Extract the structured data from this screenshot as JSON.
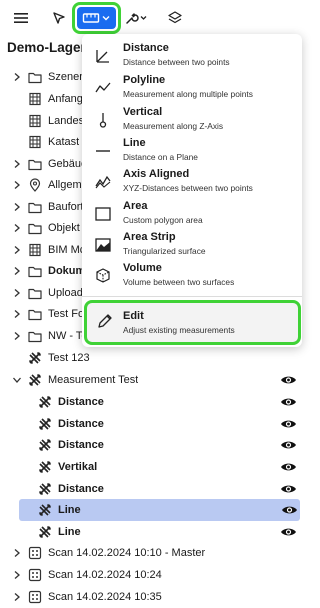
{
  "toolbar": {
    "menu_icon": "hamburger-icon",
    "select_icon": "cursor-arrow-icon",
    "measure_icon": "ruler-icon",
    "tools_icon": "wrench-icon",
    "layers_icon": "layers-icon",
    "active_color": "#1a6cf0",
    "highlight_color": "#3fd236"
  },
  "project": {
    "title": "Demo-Lager_u"
  },
  "tree": [
    {
      "label": "Szenen",
      "icon": "folder-icon"
    },
    {
      "label": "Anfang",
      "icon": "building-icon"
    },
    {
      "label": "Landest",
      "icon": "building-icon"
    },
    {
      "label": "Katast",
      "icon": "building-icon"
    },
    {
      "label": "Gebäuc",
      "icon": "folder-icon"
    },
    {
      "label": "Allgeme",
      "icon": "pin-icon"
    },
    {
      "label": "Baufort",
      "icon": "folder-icon"
    },
    {
      "label": "Objekt",
      "icon": "folder-icon"
    },
    {
      "label": "BIM Mc",
      "icon": "building-icon"
    },
    {
      "label": "Dokum",
      "icon": "folder-icon"
    },
    {
      "label": "Uploads",
      "icon": "folder-icon"
    },
    {
      "label": "Test Fo",
      "icon": "folder-icon"
    },
    {
      "label": "NW - Te",
      "icon": "folder-icon"
    },
    {
      "label": "Test 123",
      "icon": "measure-tools-icon"
    },
    {
      "label": "Measurement Test",
      "icon": "measure-tools-icon"
    },
    {
      "label": "Distance",
      "icon": "measure-tools-icon"
    },
    {
      "label": "Distance",
      "icon": "measure-tools-icon"
    },
    {
      "label": "Distance",
      "icon": "measure-tools-icon"
    },
    {
      "label": "Vertikal",
      "icon": "measure-tools-icon"
    },
    {
      "label": "Distance",
      "icon": "measure-tools-icon"
    },
    {
      "label": "Line",
      "icon": "measure-tools-icon"
    },
    {
      "label": "Line",
      "icon": "measure-tools-icon"
    },
    {
      "label": "Scan 14.02.2024 10:10 - Master",
      "icon": "scan-grid-icon"
    },
    {
      "label": "Scan 14.02.2024 10:24",
      "icon": "scan-grid-icon"
    },
    {
      "label": "Scan 14.02.2024 10:35",
      "icon": "scan-grid-icon"
    }
  ],
  "menu": {
    "items": [
      {
        "title": "Distance",
        "subtitle": "Distance between two points",
        "icon": "distance-icon"
      },
      {
        "title": "Polyline",
        "subtitle": "Measurement along multiple points",
        "icon": "polyline-icon"
      },
      {
        "title": "Vertical",
        "subtitle": "Measurement along Z-Axis",
        "icon": "vertical-icon"
      },
      {
        "title": "Line",
        "subtitle": "Distance on a Plane",
        "icon": "line-icon"
      },
      {
        "title": "Axis Aligned",
        "subtitle": "XYZ-Distances between two points",
        "icon": "axis-aligned-icon"
      },
      {
        "title": "Area",
        "subtitle": "Custom polygon area",
        "icon": "area-icon"
      },
      {
        "title": "Area Strip",
        "subtitle": "Triangularized surface",
        "icon": "area-strip-icon"
      },
      {
        "title": "Volume",
        "subtitle": "Volume between two surfaces",
        "icon": "volume-icon"
      }
    ],
    "edit": {
      "title": "Edit",
      "subtitle": "Adjust existing measurements",
      "icon": "pencil-icon"
    }
  },
  "colors": {
    "selected_row": "#b9c9f2"
  }
}
